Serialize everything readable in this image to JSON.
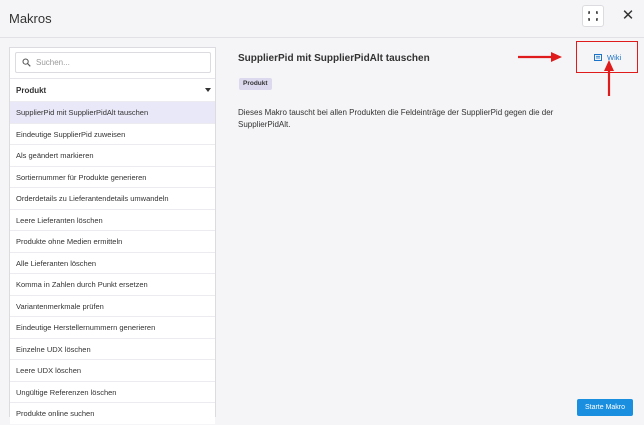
{
  "header": {
    "title": "Makros"
  },
  "sidebar": {
    "search": {
      "placeholder": "Suchen..."
    },
    "group_label": "Produkt",
    "items": [
      {
        "label": "SupplierPid mit SupplierPidAlt tauschen",
        "active": true
      },
      {
        "label": "Eindeutige SupplierPid zuweisen"
      },
      {
        "label": "Als geändert markieren"
      },
      {
        "label": "Sortiernummer für Produkte generieren"
      },
      {
        "label": "Orderdetails zu Lieferantendetails umwandeln"
      },
      {
        "label": "Leere Lieferanten löschen"
      },
      {
        "label": "Produkte ohne Medien ermitteln"
      },
      {
        "label": "Alle Lieferanten löschen"
      },
      {
        "label": "Komma in Zahlen durch Punkt ersetzen"
      },
      {
        "label": "Variantenmerkmale prüfen"
      },
      {
        "label": "Eindeutige Herstellernummern generieren"
      },
      {
        "label": "Einzelne UDX löschen"
      },
      {
        "label": "Leere UDX löschen"
      },
      {
        "label": "Ungültige Referenzen löschen"
      },
      {
        "label": "Produkte online suchen"
      }
    ]
  },
  "main": {
    "title": "SupplierPid mit SupplierPidAlt tauschen",
    "tag": "Produkt",
    "description": "Dieses Makro tauscht bei allen Produkten die Feldeinträge der SupplierPid gegen die der SupplierPidAlt.",
    "wiki_label": "Wiki",
    "start_button": "Starte Makro"
  },
  "colors": {
    "accent": "#1a8fe0",
    "link": "#1a73c9",
    "annotation": "#e01b1b",
    "selected_row": "#e9e8f8"
  },
  "icons": [
    "search-icon",
    "fullscreen-icon",
    "close-icon",
    "chevron-down-icon",
    "book-icon"
  ]
}
